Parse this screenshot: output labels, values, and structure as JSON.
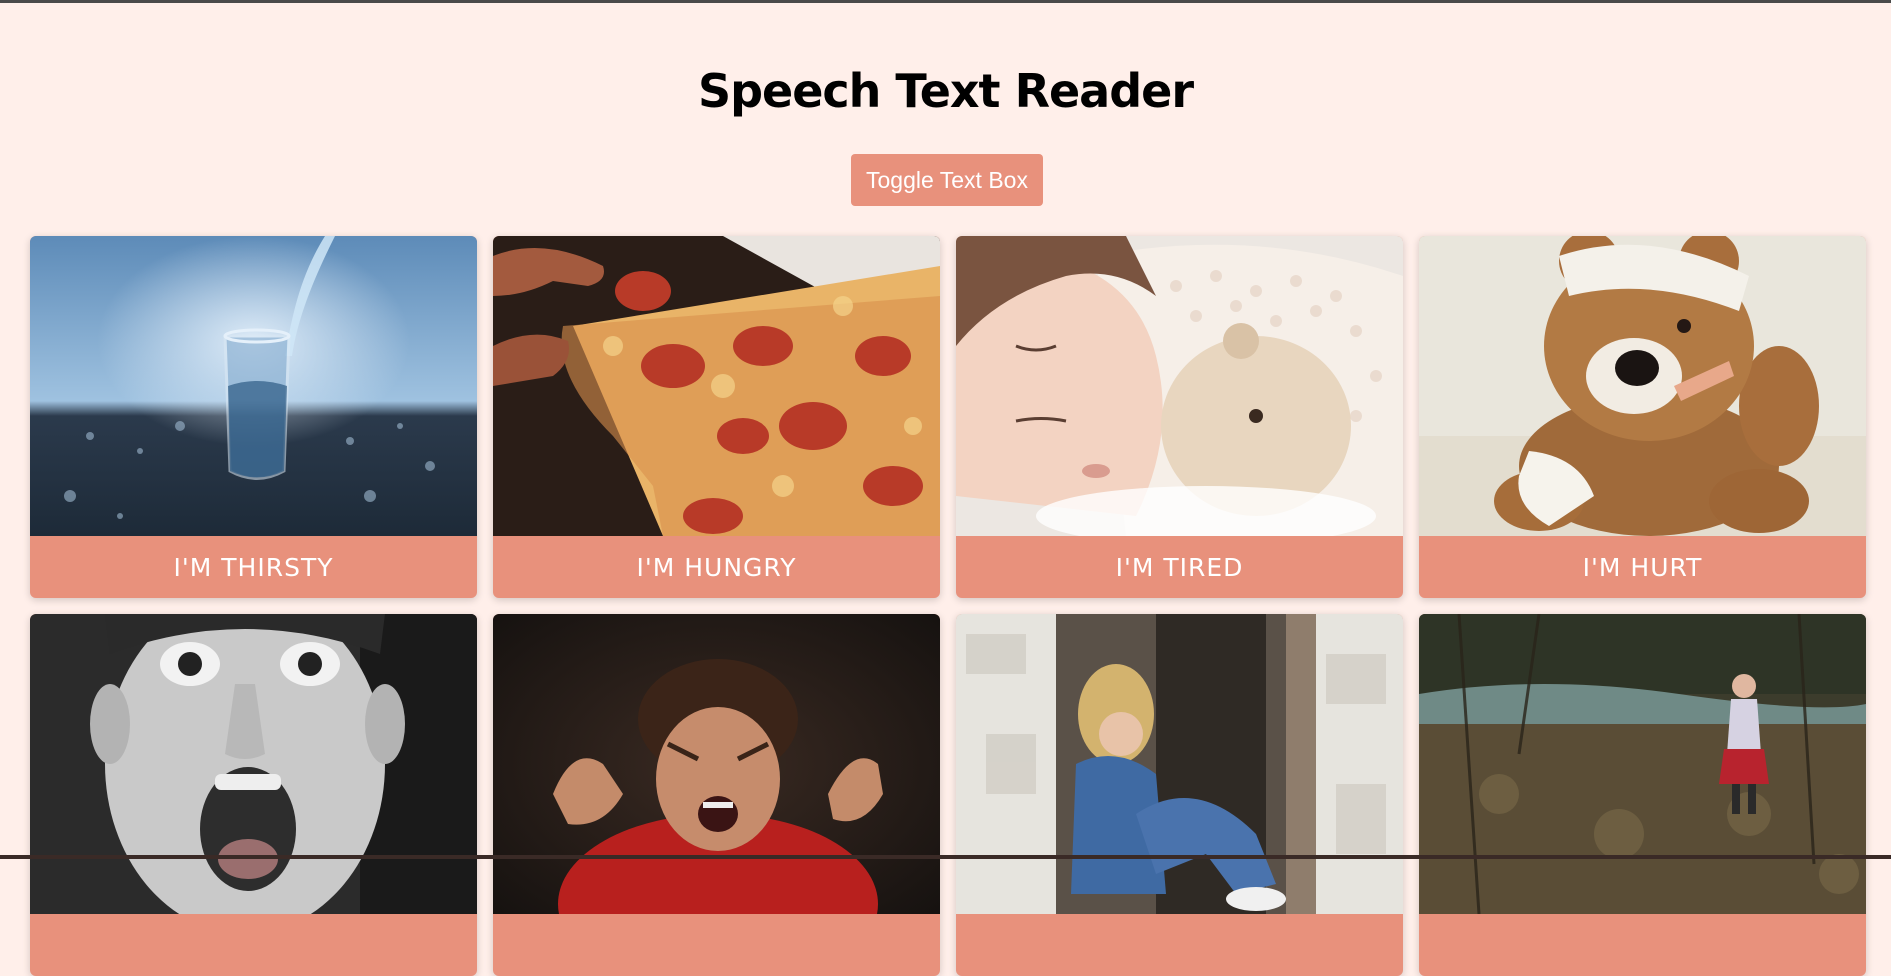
{
  "app": {
    "title": "Speech Text Reader",
    "toggle_label": "Toggle Text Box"
  },
  "cards": [
    {
      "label": "I'M THIRSTY",
      "image": "glass-of-water"
    },
    {
      "label": "I'M HUNGRY",
      "image": "pizza-slice"
    },
    {
      "label": "I'M TIRED",
      "image": "sleeping-child"
    },
    {
      "label": "I'M HURT",
      "image": "bandaged-teddy-bear"
    },
    {
      "label": "",
      "image": "surprised-boy"
    },
    {
      "label": "",
      "image": "angry-boy"
    },
    {
      "label": "",
      "image": "sad-girl-in-doorway"
    },
    {
      "label": "",
      "image": "child-in-forest"
    }
  ],
  "colors": {
    "background": "#ffefea",
    "accent": "#e8917c",
    "caption_text": "#ffffff"
  }
}
